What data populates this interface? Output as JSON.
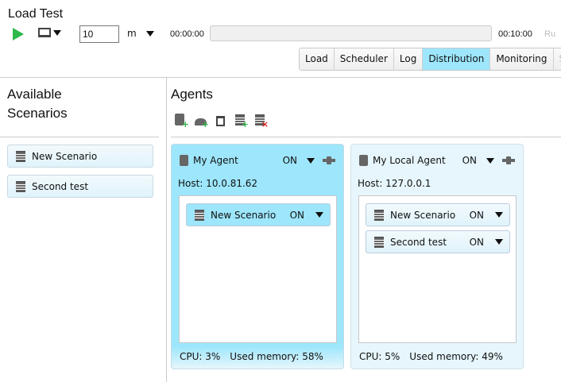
{
  "header": {
    "title": "Load Test",
    "duration_value": "10",
    "duration_unit": "m",
    "time_start": "00:00:00",
    "time_end": "00:10:00",
    "run_label": "Ru",
    "progress": 0
  },
  "tabs": [
    {
      "label": "Load"
    },
    {
      "label": "Scheduler"
    },
    {
      "label": "Log"
    },
    {
      "label": "Distribution",
      "active": true
    },
    {
      "label": "Monitoring"
    },
    {
      "label": "Scri"
    }
  ],
  "left": {
    "title_line1": "Available",
    "title_line2": "Scenarios",
    "scenarios": [
      {
        "label": "New Scenario"
      },
      {
        "label": "Second test"
      }
    ]
  },
  "agents": {
    "title": "Agents",
    "toolbar": [
      "add-agent-icon",
      "add-cloud-agent-icon",
      "trash-icon",
      "add-scenario-icon",
      "remove-scenario-icon"
    ],
    "list": [
      {
        "name": "My Agent",
        "state": "ON",
        "host": "Host: 10.0.81.62",
        "cpu": "CPU: 3%",
        "memory": "Used memory: 58%",
        "selected": true,
        "scenarios": [
          {
            "label": "New Scenario",
            "state": "ON"
          }
        ]
      },
      {
        "name": "My Local Agent",
        "state": "ON",
        "host": "Host: 127.0.0.1",
        "cpu": "CPU: 5%",
        "memory": "Used memory: 49%",
        "scenarios": [
          {
            "label": "New Scenario",
            "state": "ON"
          },
          {
            "label": "Second test",
            "state": "ON"
          }
        ]
      }
    ]
  },
  "colors": {
    "accent": "#9de6fb",
    "play": "#2eb84b",
    "card": "#e6f6fc"
  }
}
